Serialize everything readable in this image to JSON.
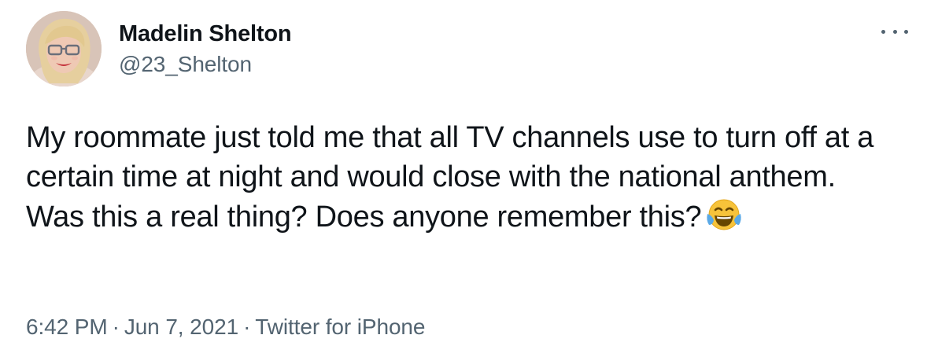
{
  "author": {
    "display_name": "Madelin Shelton",
    "handle": "@23_Shelton",
    "avatar_icon": "profile-photo"
  },
  "tweet": {
    "text": "My roommate just told me that all TV channels use to turn off at a certain time at night and would close with the national anthem. Was this a real thing? Does anyone remember this?",
    "emoji": "face-with-tears-of-joy-icon"
  },
  "meta": {
    "time": "6:42 PM",
    "separator": "·",
    "date": "Jun 7, 2021",
    "source": "Twitter for iPhone"
  },
  "icons": {
    "more": "more-options-icon"
  },
  "colors": {
    "text_primary": "#0f1419",
    "text_secondary": "#536471",
    "background": "#ffffff"
  }
}
